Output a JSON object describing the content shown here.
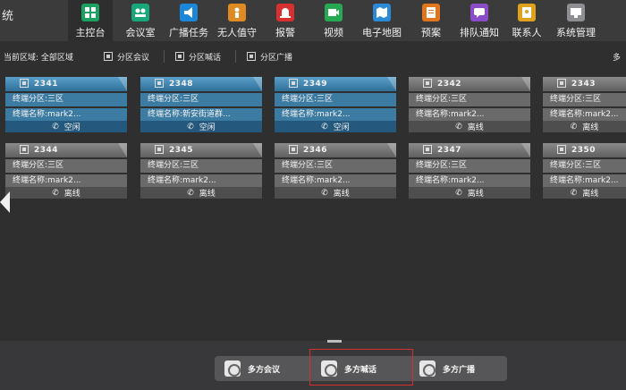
{
  "app_title": "统",
  "nav": [
    {
      "label": "主控台",
      "icon": "dashboard-icon",
      "color": "#1aa260",
      "active": true
    },
    {
      "label": "会议室",
      "icon": "meeting-room-icon",
      "color": "#18a77b"
    },
    {
      "label": "广播任务",
      "icon": "broadcast-icon",
      "color": "#1c86d9"
    },
    {
      "label": "无人值守",
      "icon": "unattended-icon",
      "color": "#e08a23"
    },
    {
      "label": "报警",
      "icon": "alarm-icon",
      "color": "#d83030"
    },
    {
      "label": "视频",
      "icon": "video-icon",
      "color": "#27a853"
    },
    {
      "label": "电子地图",
      "icon": "map-icon",
      "color": "#2a8ad8"
    },
    {
      "label": "预案",
      "icon": "plan-icon",
      "color": "#e2761d"
    },
    {
      "label": "排队通知",
      "icon": "queue-notice-icon",
      "color": "#8a4cc7"
    },
    {
      "label": "联系人",
      "icon": "contacts-icon",
      "color": "#e0a21d"
    },
    {
      "label": "系统管理",
      "icon": "system-settings-icon",
      "color": "#8d8f92"
    }
  ],
  "subbar": {
    "region_label": "当前区域:",
    "region_value": "全部区域",
    "buttons": [
      "分区会议",
      "分区喊话",
      "分区广播"
    ],
    "right_text": "多"
  },
  "cards": [
    {
      "id": "2341",
      "zone": "终端分区:三区",
      "name": "终端名称:mark2...",
      "status": "空闲",
      "state": "idle"
    },
    {
      "id": "2348",
      "zone": "终端分区:三区",
      "name": "终端名称:新安街道群...",
      "status": "空闲",
      "state": "idle"
    },
    {
      "id": "2349",
      "zone": "终端分区:三区",
      "name": "终端名称:mark2...",
      "status": "空闲",
      "state": "idle"
    },
    {
      "id": "2342",
      "zone": "终端分区:三区",
      "name": "终端名称:mark2...",
      "status": "离线",
      "state": "offline"
    },
    {
      "id": "2343",
      "zone": "终端分区:三区",
      "name": "终端名称:mark2...",
      "status": "离线",
      "state": "offline"
    },
    {
      "id": "2344",
      "zone": "终端分区:三区",
      "name": "终端名称:mark2...",
      "status": "离线",
      "state": "offline"
    },
    {
      "id": "2345",
      "zone": "终端分区:三区",
      "name": "终端名称:mark2...",
      "status": "离线",
      "state": "offline"
    },
    {
      "id": "2346",
      "zone": "终端分区:三区",
      "name": "终端名称:mark2...",
      "status": "离线",
      "state": "offline"
    },
    {
      "id": "2347",
      "zone": "终端分区:三区",
      "name": "终端名称:mark2...",
      "status": "离线",
      "state": "offline"
    },
    {
      "id": "2350",
      "zone": "终端分区:三区",
      "name": "终端名称:mark2...",
      "status": "离线",
      "state": "offline"
    }
  ],
  "bottom_buttons": [
    {
      "label": "多方会议",
      "icon": "multi-conference-icon"
    },
    {
      "label": "多方喊话",
      "icon": "multi-intercom-icon"
    },
    {
      "label": "多方广播",
      "icon": "multi-broadcast-icon"
    }
  ]
}
